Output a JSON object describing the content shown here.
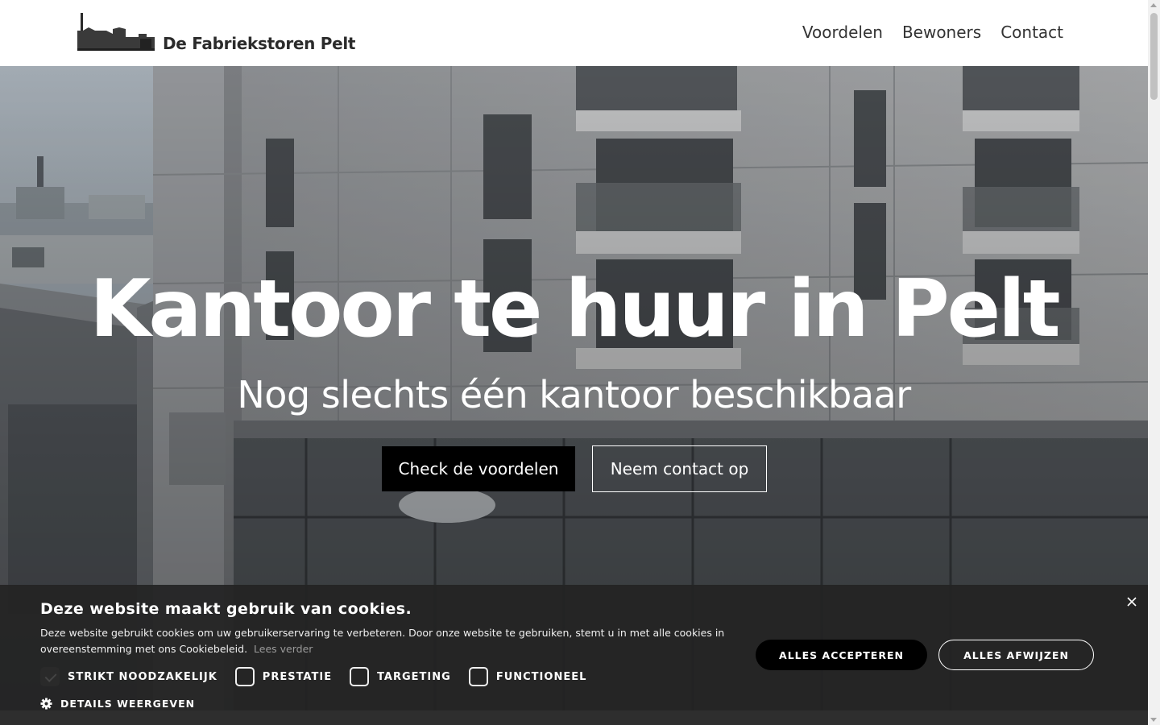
{
  "header": {
    "logo_text": "De Fabriekstoren Pelt",
    "nav": [
      "Voordelen",
      "Bewoners",
      "Contact"
    ]
  },
  "hero": {
    "title": "Kantoor te huur in Pelt",
    "subtitle": "Nog slechts één kantoor beschikbaar",
    "primary_button": "Check de voordelen",
    "secondary_button": "Neem contact op"
  },
  "cookie": {
    "title": "Deze website maakt gebruik van cookies.",
    "text": "Deze website gebruikt cookies om uw gebruikerservaring te verbeteren. Door onze website te gebruiken, stemt u in met alle cookies in overeenstemming met ons Cookiebeleid.",
    "read_more": "Lees verder",
    "checks": [
      {
        "label": "STRIKT NOODZAKELIJK",
        "checked": true
      },
      {
        "label": "PRESTATIE",
        "checked": false
      },
      {
        "label": "TARGETING",
        "checked": false
      },
      {
        "label": "FUNCTIONEEL",
        "checked": false
      }
    ],
    "details": "DETAILS WEERGEVEN",
    "accept": "ALLES ACCEPTEREN",
    "reject": "ALLES AFWIJZEN"
  },
  "icons": [
    "factory-logo-icon",
    "gear-icon",
    "close-icon"
  ]
}
